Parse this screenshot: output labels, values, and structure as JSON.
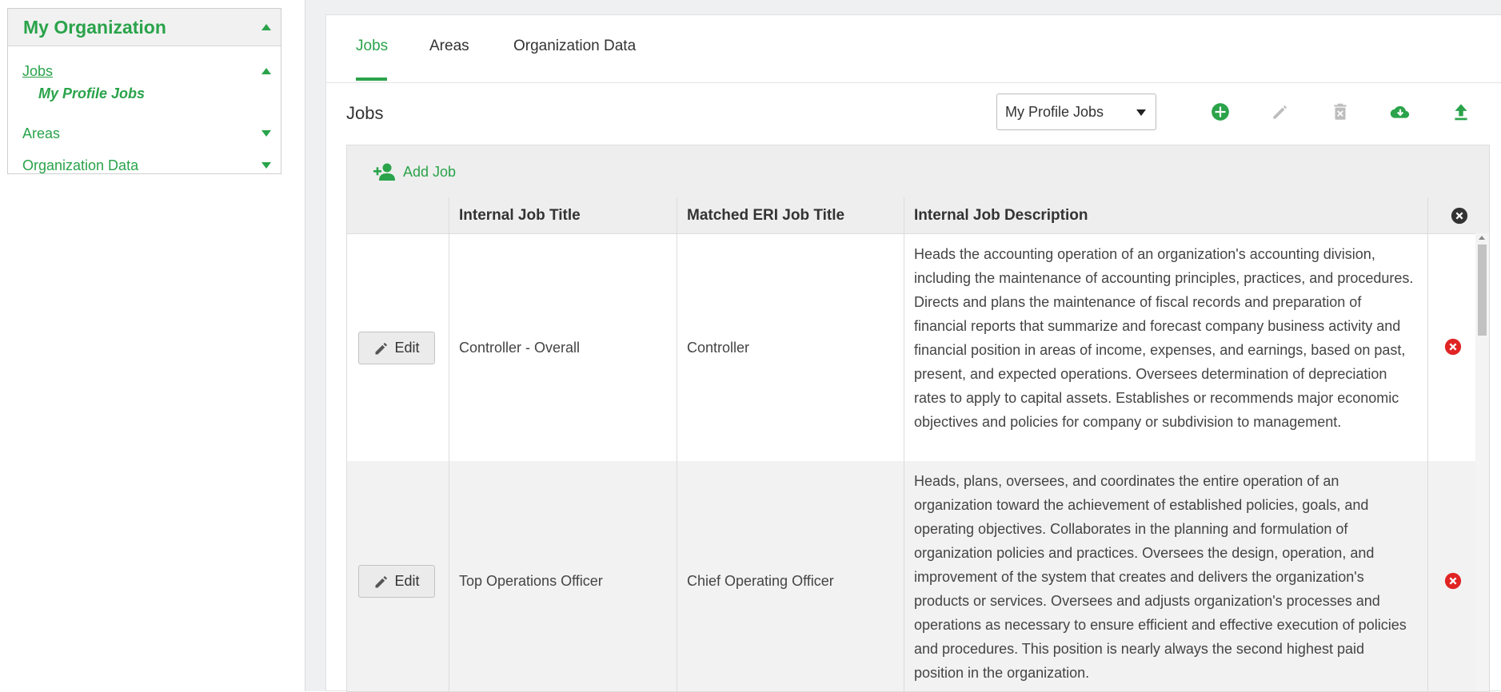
{
  "sidebar": {
    "title": "My Organization",
    "items": [
      {
        "label": "Jobs"
      },
      {
        "label": "My Profile Jobs"
      },
      {
        "label": "Areas"
      },
      {
        "label": "Organization Data"
      }
    ]
  },
  "tabs": [
    {
      "label": "Jobs"
    },
    {
      "label": "Areas"
    },
    {
      "label": "Organization Data"
    }
  ],
  "section": {
    "title": "Jobs",
    "select_value": "My Profile Jobs"
  },
  "toolbar": {
    "icons": [
      "add-circle-icon",
      "pencil-icon",
      "trash-icon",
      "cloud-download-icon",
      "upload-icon"
    ]
  },
  "grid": {
    "add_label": "Add Job",
    "columns": [
      "",
      "Internal Job Title",
      "Matched ERI Job Title",
      "Internal Job Description"
    ],
    "rows": [
      {
        "edit_label": "Edit",
        "internal_title": "Controller - Overall",
        "matched_title": "Controller",
        "description": "Heads the accounting operation of an organization's accounting division, including the maintenance of accounting principles, practices, and procedures. Directs and plans the maintenance of fiscal records and preparation of financial reports that summarize and forecast company business activity and financial position in areas of income, expenses, and earnings, based on past, present, and expected operations. Oversees determination of depreciation rates to apply to capital assets. Establishes or recommends major economic objectives and policies for company or subdivision to management."
      },
      {
        "edit_label": "Edit",
        "internal_title": "Top Operations Officer",
        "matched_title": "Chief Operating Officer",
        "description": "Heads, plans, oversees, and coordinates the entire operation of an organization toward the achievement of established policies, goals, and operating objectives. Collaborates in the planning and formulation of organization policies and practices. Oversees the design, operation, and improvement of the system that creates and delivers the organization's products or services. Oversees and adjusts organization's processes and operations as necessary to ensure efficient and effective execution of policies and procedures. This position is nearly always the second highest paid position in the organization."
      }
    ]
  },
  "colors": {
    "accent": "#2aa34a",
    "delete": "#e02424"
  }
}
